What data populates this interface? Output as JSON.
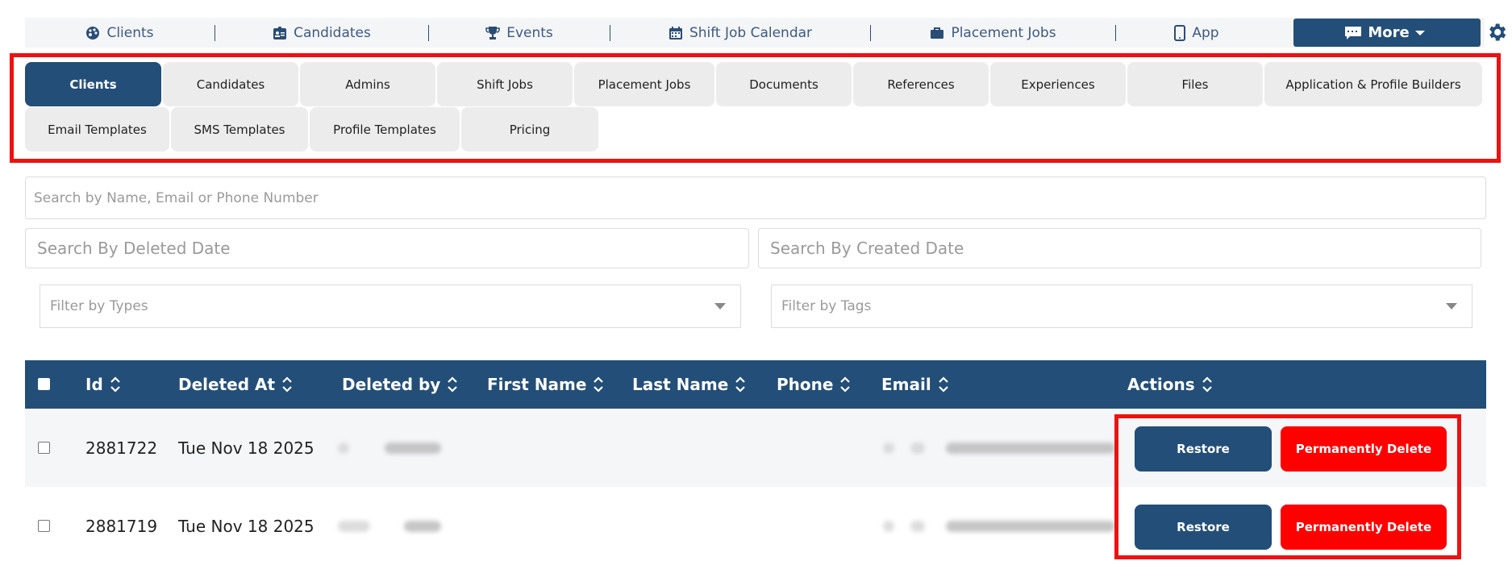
{
  "topnav": {
    "items": [
      {
        "label": "Clients",
        "icon": "palette-icon"
      },
      {
        "label": "Candidates",
        "icon": "id-badge-icon"
      },
      {
        "label": "Events",
        "icon": "trophy-icon"
      },
      {
        "label": "Shift Job Calendar",
        "icon": "calendar-icon"
      },
      {
        "label": "Placement Jobs",
        "icon": "briefcase-icon"
      },
      {
        "label": "App",
        "icon": "mobile-icon"
      }
    ],
    "more_label": "More",
    "settings_icon": "gear-icon"
  },
  "tabs": [
    {
      "label": "Clients",
      "active": true
    },
    {
      "label": "Candidates"
    },
    {
      "label": "Admins"
    },
    {
      "label": "Shift Jobs"
    },
    {
      "label": "Placement Jobs"
    },
    {
      "label": "Documents"
    },
    {
      "label": "References"
    },
    {
      "label": "Experiences"
    },
    {
      "label": "Files"
    },
    {
      "label": "Application & Profile Builders"
    },
    {
      "label": "Email Templates"
    },
    {
      "label": "SMS Templates"
    },
    {
      "label": "Profile Templates"
    },
    {
      "label": "Pricing"
    }
  ],
  "filters": {
    "search_placeholder": "Search by Name, Email or Phone Number",
    "deleted_date_placeholder": "Search By Deleted Date",
    "created_date_placeholder": "Search By Created Date",
    "types_placeholder": "Filter by Types",
    "tags_placeholder": "Filter by Tags"
  },
  "table": {
    "columns": [
      "Id",
      "Deleted At",
      "Deleted by",
      "First Name",
      "Last Name",
      "Phone",
      "Email",
      "Actions"
    ],
    "rows": [
      {
        "id": "2881722",
        "deleted_at": "Tue Nov 18 2025"
      },
      {
        "id": "2881719",
        "deleted_at": "Tue Nov 18 2025"
      }
    ],
    "restore_label": "Restore",
    "delete_label": "Permanently Delete"
  },
  "colors": {
    "primary": "#234e78",
    "danger": "#ff0000",
    "highlight": "#ee1111"
  }
}
